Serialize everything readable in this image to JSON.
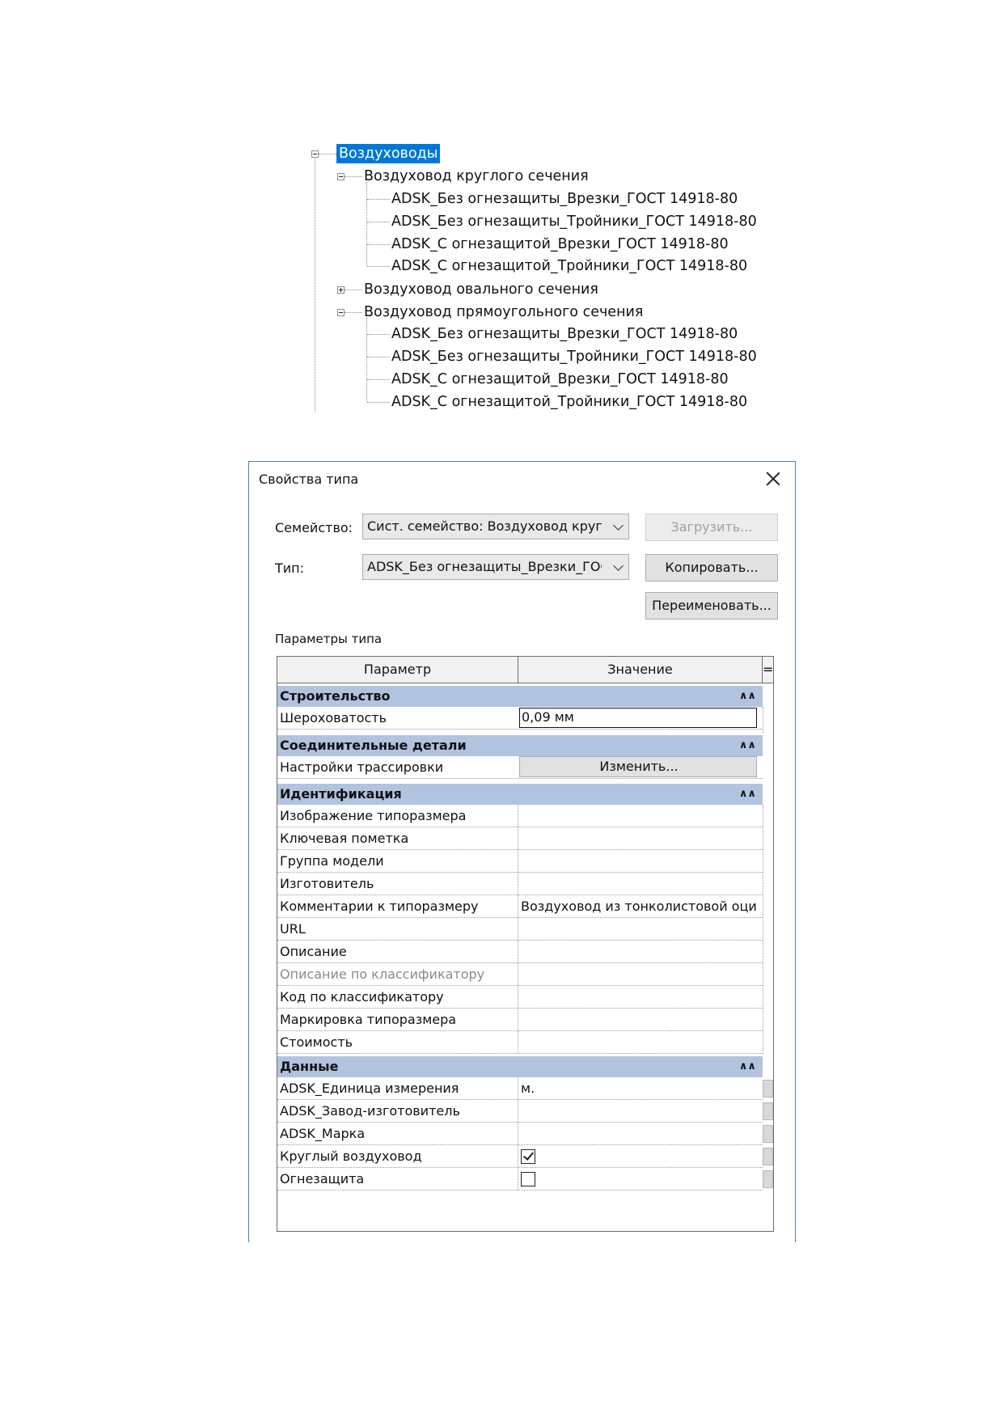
{
  "tree": {
    "root": "Воздуховоды",
    "groups": [
      {
        "label": "Воздуховод круглого сечения",
        "expanded": true,
        "items": [
          "ADSK_Без огнезащиты_Врезки_ГОСТ 14918-80",
          "ADSK_Без огнезащиты_Тройники_ГОСТ 14918-80",
          "ADSK_С огнезащитой_Врезки_ГОСТ 14918-80",
          "ADSK_С огнезащитой_Тройники_ГОСТ 14918-80"
        ]
      },
      {
        "label": "Воздуховод овального сечения",
        "expanded": false,
        "items": []
      },
      {
        "label": "Воздуховод прямоугольного сечения",
        "expanded": true,
        "items": [
          "ADSK_Без огнезащиты_Врезки_ГОСТ 14918-80",
          "ADSK_Без огнезащиты_Тройники_ГОСТ 14918-80",
          "ADSK_С огнезащитой_Врезки_ГОСТ 14918-80",
          "ADSK_С огнезащитой_Тройники_ГОСТ 14918-80"
        ]
      }
    ]
  },
  "dialog": {
    "title": "Свойства типа",
    "family_label": "Семейство:",
    "family_value": "Сист. семейство: Воздуховод кругло",
    "type_label": "Тип:",
    "type_value": "ADSK_Без огнезащиты_Врезки_ГОСТ",
    "load_button": "Загрузить...",
    "copy_button": "Копировать...",
    "rename_button": "Переименовать...",
    "params_label": "Параметры типа",
    "columns": {
      "param": "Параметр",
      "value": "Значение",
      "menu": "="
    },
    "groups": [
      {
        "name": "Строительство",
        "rows": [
          {
            "param": "Шероховатость",
            "value": "0,09 мм",
            "kind": "edit"
          }
        ]
      },
      {
        "name": "Соединительные детали",
        "rows": [
          {
            "param": "Настройки трассировки",
            "value": "Изменить...",
            "kind": "button"
          }
        ]
      },
      {
        "name": "Идентификация",
        "rows": [
          {
            "param": "Изображение типоразмера",
            "value": ""
          },
          {
            "param": "Ключевая пометка",
            "value": ""
          },
          {
            "param": "Группа модели",
            "value": ""
          },
          {
            "param": "Изготовитель",
            "value": ""
          },
          {
            "param": "Комментарии к типоразмеру",
            "value": "Воздуховод из тонколистовой оци"
          },
          {
            "param": "URL",
            "value": ""
          },
          {
            "param": "Описание",
            "value": ""
          },
          {
            "param": "Описание по классификатору",
            "value": "",
            "dim": true
          },
          {
            "param": "Код по классификатору",
            "value": ""
          },
          {
            "param": "Маркировка типоразмера",
            "value": ""
          },
          {
            "param": "Стоимость",
            "value": ""
          }
        ]
      },
      {
        "name": "Данные",
        "rows": [
          {
            "param": "ADSK_Единица измерения",
            "value": "м."
          },
          {
            "param": "ADSK_Завод-изготовитель",
            "value": ""
          },
          {
            "param": "ADSK_Марка",
            "value": ""
          },
          {
            "param": "Круглый воздуховод",
            "value": "",
            "kind": "checkbox",
            "checked": true
          },
          {
            "param": "Огнезащита",
            "value": "",
            "kind": "checkbox",
            "checked": false
          }
        ]
      }
    ]
  },
  "colors": {
    "selection": "#0078d7",
    "group_header": "#b2c3df",
    "dialog_border": "#4f7fbf"
  }
}
